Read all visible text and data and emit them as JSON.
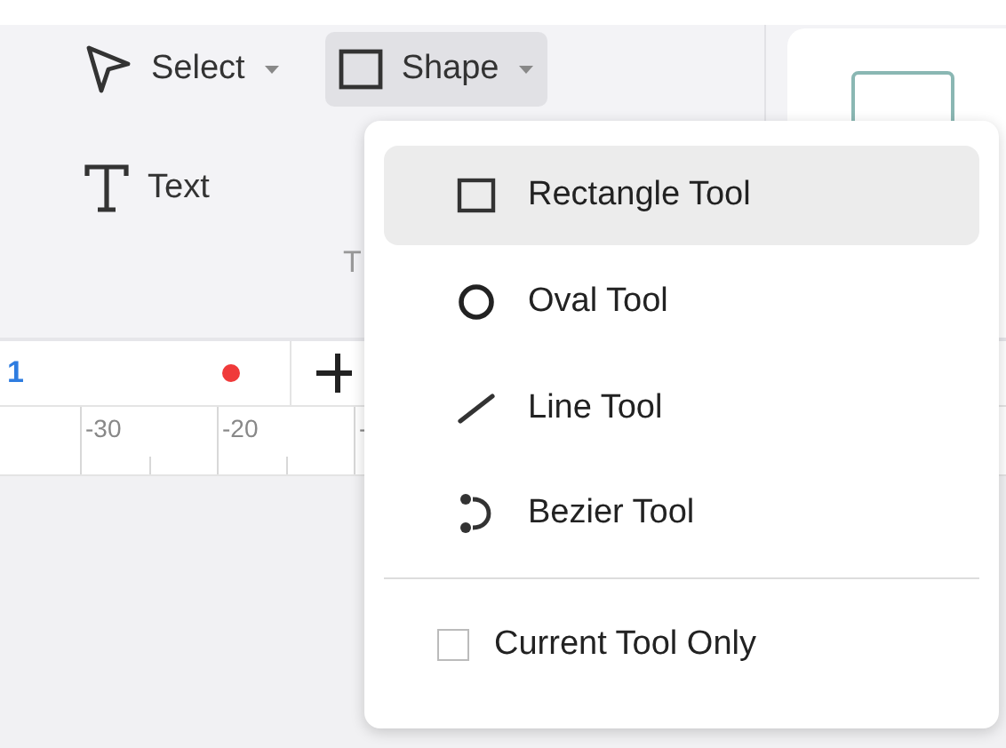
{
  "toolbar": {
    "buttons": [
      {
        "label": "Select",
        "selected": false
      },
      {
        "label": "Shape",
        "selected": true
      }
    ],
    "text_button": {
      "label": "Text"
    },
    "group_label": "T"
  },
  "document_tabs": [
    {
      "label": "1",
      "unsaved": true
    }
  ],
  "ruler": {
    "labels": [
      "-30",
      "-20",
      "-"
    ]
  },
  "menu": {
    "items": [
      {
        "kind": "rectangle",
        "label": "Rectangle Tool",
        "selected": true
      },
      {
        "kind": "oval",
        "label": "Oval Tool",
        "selected": false
      },
      {
        "kind": "line",
        "label": "Line Tool",
        "selected": false
      },
      {
        "kind": "bezier",
        "label": "Bezier Tool",
        "selected": false
      },
      {
        "kind": "separator"
      },
      {
        "kind": "check",
        "label": "Current Tool Only",
        "checked": false
      }
    ]
  }
}
